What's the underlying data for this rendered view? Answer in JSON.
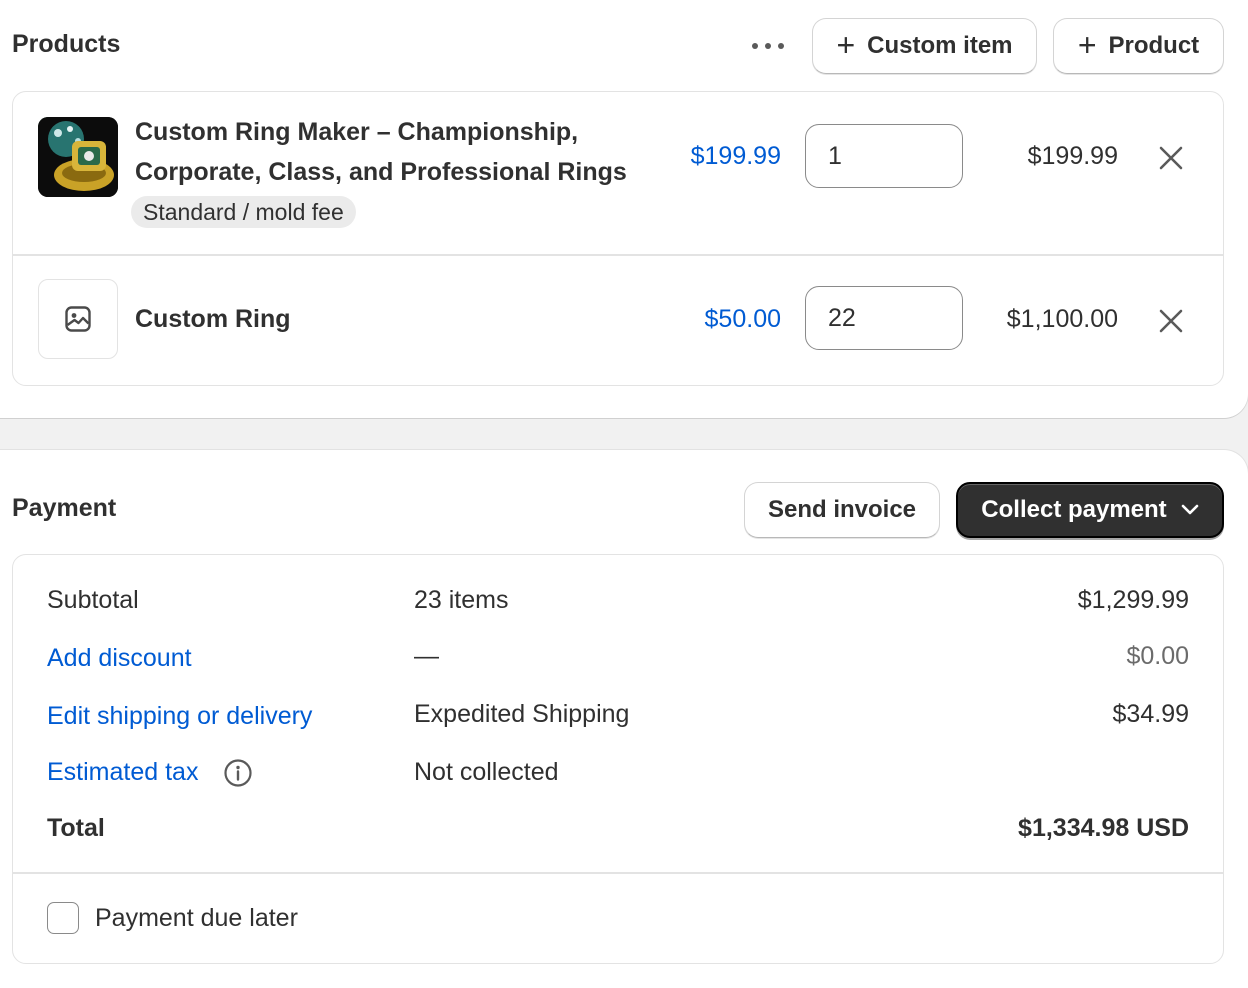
{
  "products": {
    "title": "Products",
    "more_icon": "more-horizontal-icon",
    "custom_item_label": "Custom item",
    "product_label": "Product",
    "items": [
      {
        "name_line1": "Custom Ring Maker – Championship,",
        "name_line2": "Corporate, Class, and Professional Rings",
        "variant": "Standard / mold fee",
        "unit_price": "$199.99",
        "quantity": "1",
        "line_total": "$199.99",
        "image_icon": "ring-product-image"
      },
      {
        "name": "Custom Ring",
        "unit_price": "$50.00",
        "quantity": "22",
        "line_total": "$1,100.00",
        "image_icon": "image-placeholder-icon"
      }
    ]
  },
  "payment": {
    "title": "Payment",
    "send_invoice_label": "Send invoice",
    "collect_payment_label": "Collect payment",
    "rows": {
      "subtotal": {
        "label": "Subtotal",
        "detail": "23 items",
        "amount": "$1,299.99"
      },
      "discount": {
        "label": "Add discount",
        "detail": "—",
        "amount": "$0.00"
      },
      "shipping": {
        "label": "Edit shipping or delivery",
        "detail": "Expedited Shipping",
        "amount": "$34.99"
      },
      "tax": {
        "label": "Estimated tax",
        "detail": "Not collected"
      },
      "total": {
        "label": "Total",
        "amount": "$1,334.98 USD"
      }
    },
    "payment_due_later_label": "Payment due later",
    "payment_due_later_checked": false
  },
  "colors": {
    "link": "#005bd3",
    "primary_button": "#303030",
    "text": "#303030",
    "border": "#e3e3e3"
  }
}
